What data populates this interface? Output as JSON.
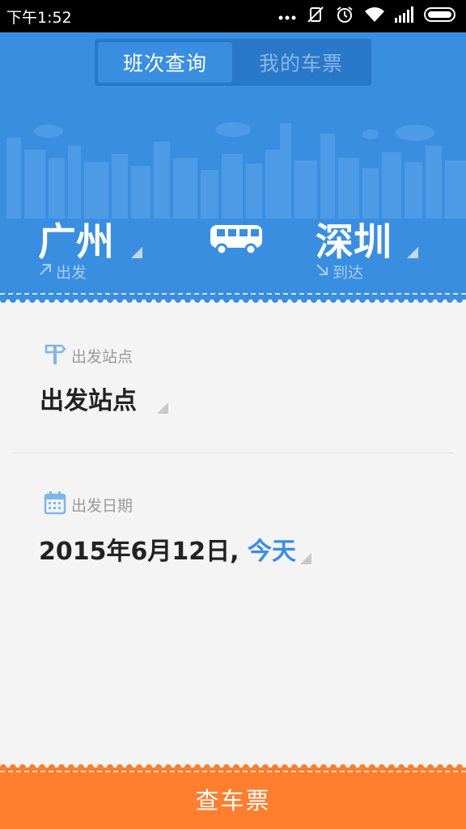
{
  "status_bar": {
    "time": "下午1:52",
    "icons": [
      "more-dots-icon",
      "vibrate-mute-icon",
      "alarm-icon",
      "wifi-icon",
      "signal-icon",
      "battery-icon"
    ]
  },
  "tabs": [
    {
      "label": "班次查询",
      "active": true
    },
    {
      "label": "我的车票",
      "active": false
    }
  ],
  "route": {
    "from_city": "广州",
    "from_label": "出发",
    "to_city": "深圳",
    "to_label": "到达",
    "icon": "bus-icon"
  },
  "station": {
    "label": "出发站点",
    "value": "出发站点",
    "icon": "signpost-icon"
  },
  "date": {
    "label": "出发日期",
    "value": "2015年6月12日,",
    "relative": "今天",
    "icon": "calendar-icon"
  },
  "submit": {
    "label": "查车票"
  },
  "colors": {
    "primary_blue": "#3a8ee0",
    "segment_bg": "#2978c9",
    "accent_orange": "#ff7f2e",
    "background": "#f4f4f4"
  }
}
